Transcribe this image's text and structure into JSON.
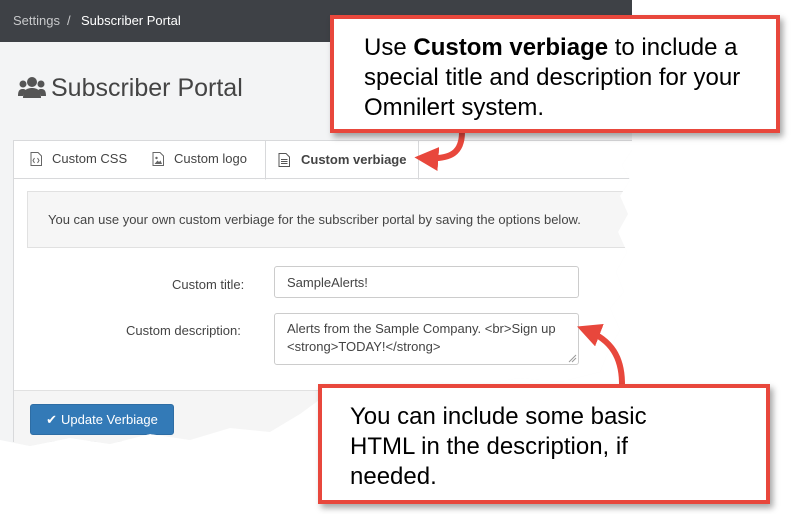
{
  "breadcrumb": {
    "settings": "Settings",
    "separator": "/",
    "current": "Subscriber Portal"
  },
  "page": {
    "title": "Subscriber Portal",
    "icon": "users-icon"
  },
  "tabs": [
    {
      "label": "Custom CSS",
      "icon": "code-file-icon"
    },
    {
      "label": "Custom logo",
      "icon": "image-icon"
    },
    {
      "label": "Custom verbiage",
      "icon": "text-file-icon",
      "active": true
    }
  ],
  "info": {
    "text": "You can use your own custom verbiage for the subscriber portal by saving the options below."
  },
  "form": {
    "title_label": "Custom title:",
    "title_value": "SampleAlerts!",
    "description_label": "Custom description:",
    "description_value": "Alerts from the Sample Company. <br>Sign up <strong>TODAY!</strong>"
  },
  "actions": {
    "update_label": "Update Verbiage",
    "update_icon": "checkmark-icon"
  },
  "callouts": {
    "top_prefix": "Use ",
    "top_bold": "Custom verbiage",
    "top_suffix": " to include a special title and description for your Omnilert system.",
    "bottom": "You can include some basic HTML in the description, if needed."
  },
  "colors": {
    "topbar": "#3e4146",
    "accent": "#337ab7",
    "callout_border": "#e8473c"
  }
}
